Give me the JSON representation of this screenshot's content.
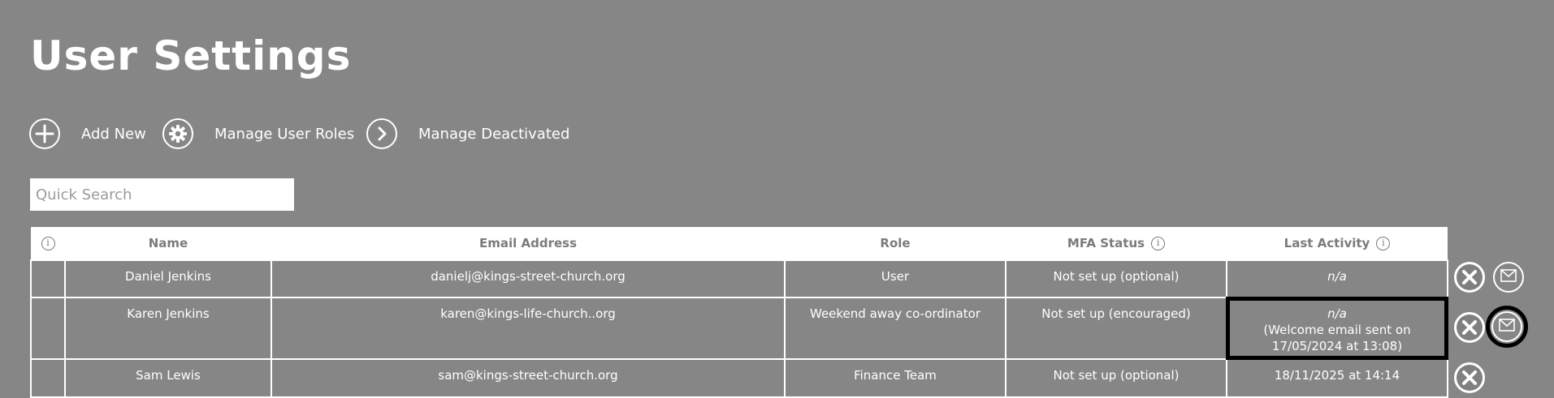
{
  "page": {
    "title": "User Settings"
  },
  "toolbar": {
    "add_new": "Add New",
    "manage_roles": "Manage User Roles",
    "manage_deactivated": "Manage Deactivated"
  },
  "search": {
    "placeholder": "Quick Search",
    "value": ""
  },
  "table": {
    "headers": {
      "info": "i",
      "name": "Name",
      "email": "Email Address",
      "role": "Role",
      "mfa": "MFA Status",
      "last_activity": "Last Activity"
    },
    "rows": [
      {
        "name": "Daniel Jenkins",
        "email": "danielj@kings-street-church.org",
        "role": "User",
        "mfa": "Not set up (optional)",
        "last_activity": "n/a",
        "last_activity_note": ""
      },
      {
        "name": "Karen Jenkins",
        "email": "karen@kings-life-church..org",
        "role": "Weekend away co-ordinator",
        "mfa": "Not set up (encouraged)",
        "last_activity": "n/a",
        "last_activity_note": "(Welcome email sent on 17/05/2024 at 13:08)"
      },
      {
        "name": "Sam Lewis",
        "email": "sam@kings-street-church.org",
        "role": "Finance Team",
        "mfa": "Not set up (optional)",
        "last_activity": "18/11/2025 at 14:14",
        "last_activity_note": ""
      }
    ]
  },
  "icons": {
    "add": "plus-circle-icon",
    "roles": "gear-icon",
    "deactivated": "chevron-right-icon",
    "deactivate_user": "close-circle-icon",
    "send_email": "envelope-icon",
    "info": "info-icon"
  },
  "colors": {
    "background": "#868686",
    "header_bg": "#ffffff",
    "header_text": "#7b7b7b",
    "highlight": "#000000"
  }
}
